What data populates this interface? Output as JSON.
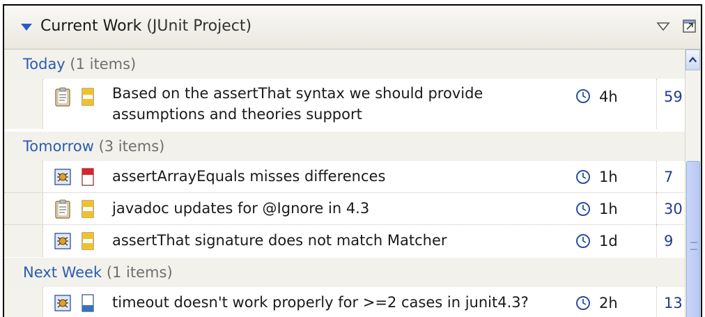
{
  "header": {
    "title": "Current Work",
    "project": "(JUnit Project)",
    "icons": [
      "collapse-triangle-icon",
      "view-menu-icon",
      "maximize-icon"
    ]
  },
  "categories": [
    {
      "label": "Today",
      "count": "(1 items)"
    },
    {
      "label": "Tomorrow",
      "count": "(3 items)"
    },
    {
      "label": "Next Week",
      "count": "(1 items)"
    }
  ],
  "tasks": [
    {
      "type": "task-icon",
      "priority": "P3",
      "summary_line1": "Based on the assertThat syntax we should provide",
      "summary_line2": "assumptions and theories support",
      "estimate": "4h",
      "id": "59"
    },
    {
      "type": "bug-icon",
      "priority": "P1",
      "summary_line1": "assertArrayEquals misses differences",
      "estimate": "1h",
      "id": "7"
    },
    {
      "type": "task-icon",
      "priority": "P3",
      "summary_line1": "javadoc updates for @Ignore in 4.3",
      "estimate": "1h",
      "id": "30"
    },
    {
      "type": "bug-icon",
      "priority": "P3",
      "summary_line1": "assertThat signature does not match Matcher",
      "estimate": "1d",
      "id": "9"
    },
    {
      "type": "bug-icon",
      "priority": "P5",
      "summary_line1": "timeout doesn't work properly for >=2 cases in junit4.3?",
      "estimate": "2h",
      "id": "13"
    }
  ],
  "colors": {
    "accent": "#2a5cc6",
    "p1": "#d8242b",
    "p3": "#f0c12a",
    "p5": "#3a6fc0",
    "id_text": "#233a8f"
  }
}
